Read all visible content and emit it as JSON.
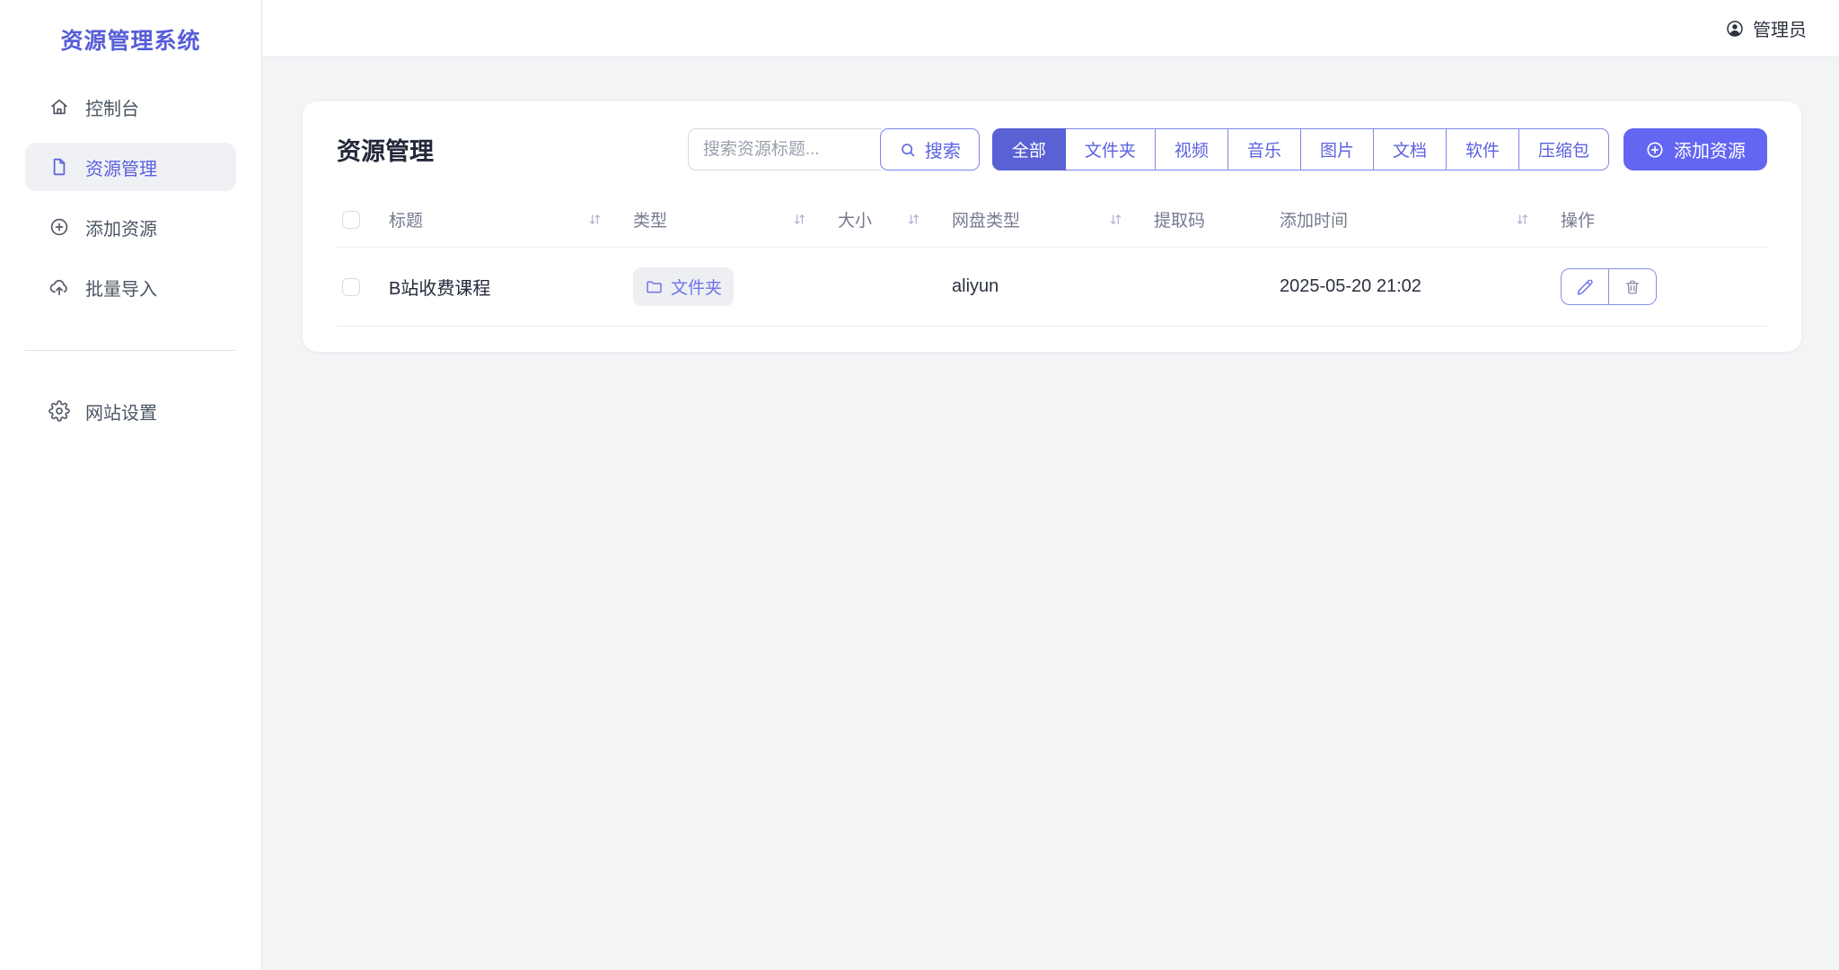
{
  "app": {
    "title": "资源管理系统"
  },
  "header": {
    "user_label": "管理员",
    "user_icon": "person-circle-icon"
  },
  "sidebar": {
    "items": [
      {
        "label": "控制台",
        "icon": "home-icon",
        "active": false
      },
      {
        "label": "资源管理",
        "icon": "document-icon",
        "active": true
      },
      {
        "label": "添加资源",
        "icon": "plus-circle-icon",
        "active": false
      },
      {
        "label": "批量导入",
        "icon": "cloud-upload-icon",
        "active": false
      },
      {
        "label": "网站设置",
        "icon": "gear-icon",
        "active": false
      }
    ]
  },
  "main": {
    "page_title": "资源管理",
    "search": {
      "value": "",
      "placeholder": "搜索资源标题...",
      "button_label": "搜索",
      "button_icon": "search-icon"
    },
    "filters": [
      "全部",
      "文件夹",
      "视频",
      "音乐",
      "图片",
      "文档",
      "软件",
      "压缩包"
    ],
    "active_filter": "全部",
    "add_button": {
      "label": "添加资源",
      "icon": "plus-circle-icon"
    },
    "table": {
      "columns": [
        {
          "label": "标题",
          "sortable": true
        },
        {
          "label": "类型",
          "sortable": true
        },
        {
          "label": "大小",
          "sortable": true
        },
        {
          "label": "网盘类型",
          "sortable": true
        },
        {
          "label": "提取码",
          "sortable": false
        },
        {
          "label": "添加时间",
          "sortable": true
        },
        {
          "label": "操作",
          "sortable": false
        }
      ],
      "rows": [
        {
          "title": "B站收费课程",
          "type_label": "文件夹",
          "type_icon": "folder-icon",
          "size": "",
          "disk_type": "aliyun",
          "code": "",
          "added_at": "2025-05-20 21:02"
        }
      ]
    }
  },
  "colors": {
    "primary": "#6366f1",
    "active_segment": "#5a61d4",
    "brand_text": "#575dd8",
    "page_background": "#f3f4f6",
    "border": "#e7e8ec"
  }
}
